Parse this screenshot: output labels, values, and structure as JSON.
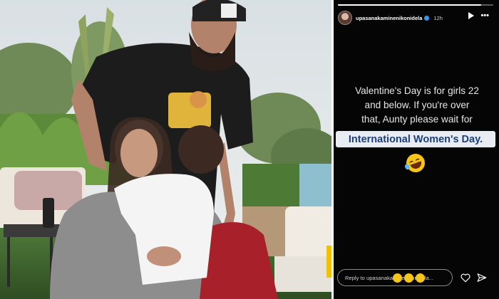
{
  "story": {
    "username": "upasanakaminenikonidela",
    "time": "12h",
    "progress": 0.92,
    "text_lines": [
      "Valentine's Day is for girls 22",
      "and below. If you're over",
      "that, Aunty please wait for"
    ],
    "highlight_text": "International Women's Day.",
    "emoji": "rolling-on-floor-laughing",
    "reply_placeholder": "Reply to upasanakaminenikonidela...",
    "icons": [
      "play-icon",
      "more-icon",
      "heart-icon",
      "send-icon"
    ]
  },
  "colors": {
    "story_bg": "#050505",
    "highlight_bg": "#e9edf3",
    "highlight_text": "#1a3f7a"
  }
}
